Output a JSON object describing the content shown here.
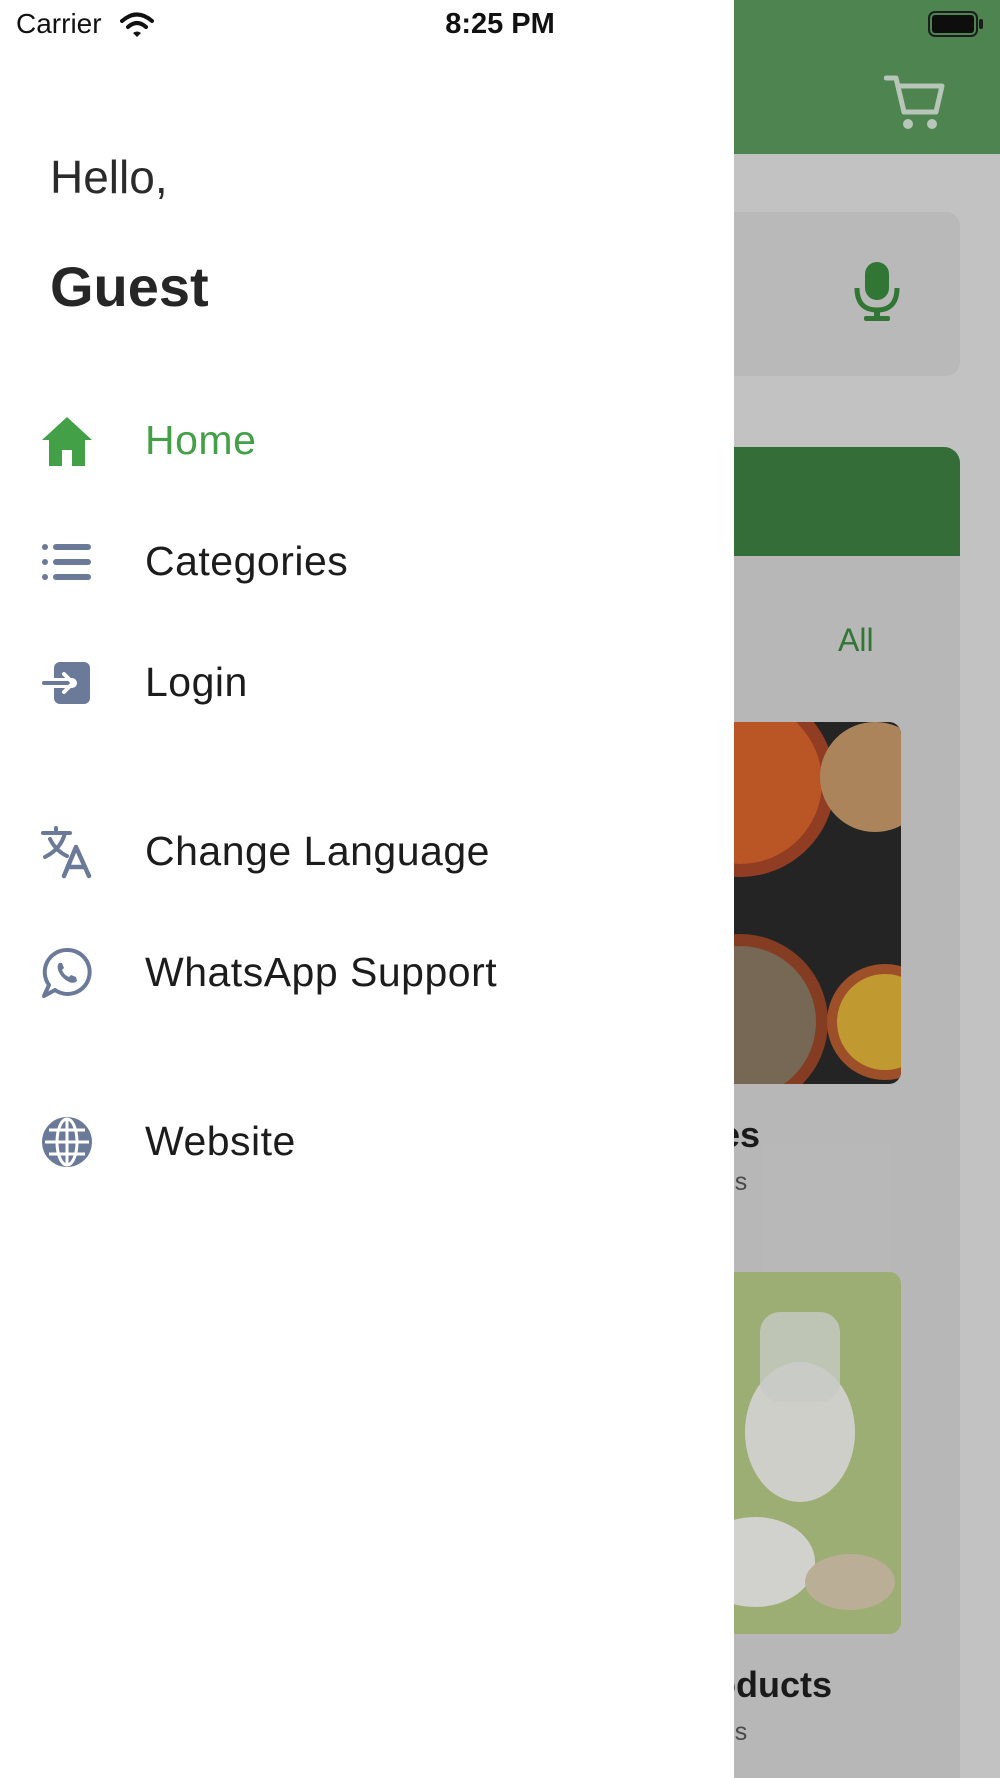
{
  "status_bar": {
    "carrier": "Carrier",
    "time": "8:25 PM"
  },
  "drawer": {
    "greeting": "Hello,",
    "username": "Guest",
    "menu": [
      {
        "label": "Home",
        "icon": "home-icon",
        "active": true
      },
      {
        "label": "Categories",
        "icon": "list-icon",
        "active": false
      },
      {
        "label": "Login",
        "icon": "login-icon",
        "active": false
      },
      {
        "label": "Change Language",
        "icon": "translate-icon",
        "active": false
      },
      {
        "label": "WhatsApp Support",
        "icon": "whatsapp-icon",
        "active": false
      },
      {
        "label": "Website",
        "icon": "globe-icon",
        "active": false
      }
    ]
  },
  "background_app": {
    "view_all_label": "All",
    "categories": [
      {
        "title": "ses",
        "subtitle": "ems"
      },
      {
        "title": "roducts",
        "subtitle": "ems"
      }
    ]
  },
  "colors": {
    "accent_green": "#43a047",
    "header_green": "#5a9a5e",
    "banner_green": "#3d7f40",
    "icon_slate": "#6b7a99"
  }
}
